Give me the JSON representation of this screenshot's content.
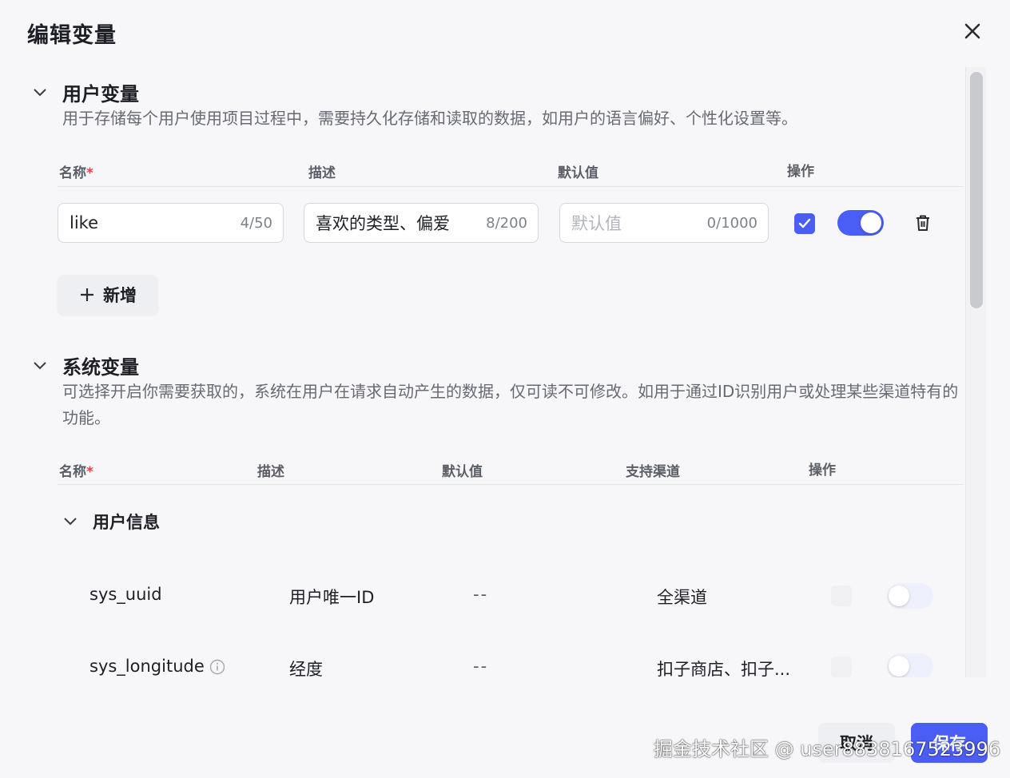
{
  "dialog": {
    "title": "编辑变量"
  },
  "user_section": {
    "title": "用户变量",
    "desc": "用于存储每个用户使用项目过程中，需要持久化存储和读取的数据，如用户的语言偏好、个性化设置等。",
    "columns": {
      "name": "名称",
      "required": "*",
      "desc": "描述",
      "default": "默认值",
      "action": "操作"
    },
    "row": {
      "name_value": "like",
      "name_count": "4/50",
      "desc_value": "喜欢的类型、偏爱",
      "desc_count": "8/200",
      "default_placeholder": "默认值",
      "default_count": "0/1000",
      "checked": true,
      "enabled": true
    },
    "add_label": "新增"
  },
  "system_section": {
    "title": "系统变量",
    "desc": "可选择开启你需要获取的，系统在用户在请求自动产生的数据，仅可读不可修改。如用于通过ID识别用户或处理某些渠道特有的功能。",
    "columns": {
      "name": "名称",
      "required": "*",
      "desc": "描述",
      "default": "默认值",
      "channel": "支持渠道",
      "action": "操作"
    },
    "group": {
      "title": "用户信息",
      "rows": [
        {
          "name": "sys_uuid",
          "desc": "用户唯一ID",
          "default": "--",
          "channel": "全渠道",
          "enabled": false
        },
        {
          "name": "sys_longitude",
          "desc": "经度",
          "default": "--",
          "channel": "扣子商店、扣子...",
          "enabled": false
        }
      ]
    }
  },
  "footer": {
    "cancel": "取消",
    "save": "保存"
  },
  "watermark": "掘金技术社区 @ user8838167523996",
  "colors": {
    "accent": "#4a5df5",
    "required": "#e54545"
  }
}
